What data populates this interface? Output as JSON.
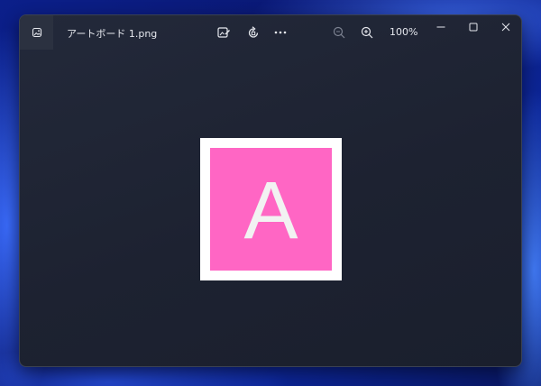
{
  "window": {
    "title": "アートボード 1.png",
    "zoom_level": "100%"
  },
  "toolbar": {
    "edit_icon": "edit-image-icon",
    "rotate_icon": "rotate-icon",
    "more_icon": "more-icon",
    "zoom_out_icon": "zoom-out-icon",
    "zoom_in_icon": "zoom-in-icon"
  },
  "image": {
    "letter": "A",
    "background_color": "#ff66c4",
    "border_color": "#ffffff"
  },
  "colors": {
    "window_bg": "#1d2231",
    "desktop_accent": "#0c2596"
  }
}
